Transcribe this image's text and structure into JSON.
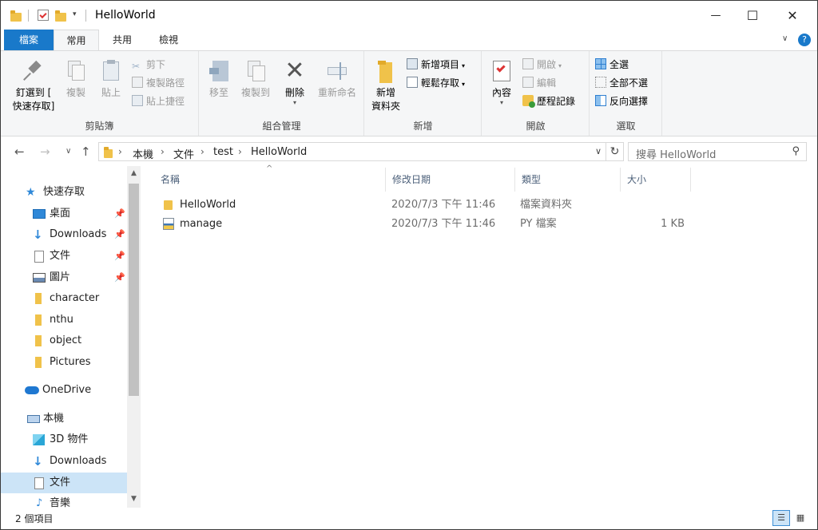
{
  "window": {
    "title": "HelloWorld",
    "minimize": "—",
    "maximize": "☐",
    "close": "✕"
  },
  "tabs": [
    {
      "label": "檔案"
    },
    {
      "label": "常用"
    },
    {
      "label": "共用"
    },
    {
      "label": "檢視"
    }
  ],
  "help_icon": "?",
  "ribbon": {
    "clipboard": {
      "label": "剪貼簿",
      "pin_line1": "釘選到 [",
      "pin_line2": "快速存取]",
      "copy": "複製",
      "paste": "貼上",
      "cut": "剪下",
      "copy_path": "複製路徑",
      "paste_shortcut": "貼上捷徑"
    },
    "organize": {
      "label": "組合管理",
      "move_to": "移至",
      "copy_to": "複製到",
      "delete": "刪除",
      "rename": "重新命名"
    },
    "new": {
      "label": "新增",
      "new_folder_line1": "新增",
      "new_folder_line2": "資料夾",
      "new_item": "新增項目",
      "easy_access": "輕鬆存取"
    },
    "open": {
      "label": "開啟",
      "properties": "內容",
      "open": "開啟",
      "edit": "編輯",
      "history": "歷程記錄"
    },
    "select": {
      "label": "選取",
      "select_all": "全選",
      "select_none": "全部不選",
      "invert": "反向選擇"
    }
  },
  "address": {
    "back": "←",
    "forward": "→",
    "recent": "∨",
    "up": "↑",
    "crumbs": [
      "本機",
      "文件",
      "test",
      "HelloWorld"
    ],
    "separator": "›",
    "dropdown": "∨",
    "refresh": "↻",
    "search_placeholder": "搜尋 HelloWorld",
    "search_icon": "⚲"
  },
  "nav": {
    "quick_access": "快速存取",
    "desktop": "桌面",
    "downloads_pinned": "Downloads",
    "documents_pinned": "文件",
    "pictures_pinned": "圖片",
    "folders": [
      "character",
      "nthu",
      "object",
      "Pictures"
    ],
    "onedrive": "OneDrive",
    "this_pc": "本機",
    "objects_3d": "3D 物件",
    "downloads": "Downloads",
    "documents": "文件",
    "music": "音樂",
    "pin": "📌",
    "scroll_up": "▲",
    "scroll_down": "▼"
  },
  "columns": {
    "name": "名稱",
    "modified": "修改日期",
    "type": "類型",
    "size": "大小",
    "sort_indicator": "^"
  },
  "files": [
    {
      "name": "HelloWorld",
      "modified": "2020/7/3 下午 11:46",
      "type": "檔案資料夾",
      "size": "",
      "icon": "folder-icon"
    },
    {
      "name": "manage",
      "modified": "2020/7/3 下午 11:46",
      "type": "PY 檔案",
      "size": "1 KB",
      "icon": "python-file-icon"
    }
  ],
  "status": {
    "item_count": "2 個項目"
  },
  "colors": {
    "file_tab": "#1979ca",
    "selection": "#cce4f7",
    "folder": "#f0c24a",
    "ribbon_bg": "#f5f6f7"
  }
}
